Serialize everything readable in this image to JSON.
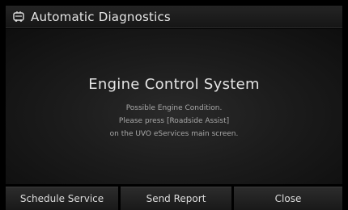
{
  "header": {
    "icon": "car-diagnostics-icon",
    "title": "Automatic Diagnostics"
  },
  "main": {
    "heading": "Engine Control System",
    "message_lines": [
      "Possible Engine Condition.",
      "Please press [Roadside Assist]",
      "on the UVO eServices main screen."
    ]
  },
  "buttons": {
    "schedule": "Schedule Service",
    "send": "Send Report",
    "close": "Close"
  }
}
